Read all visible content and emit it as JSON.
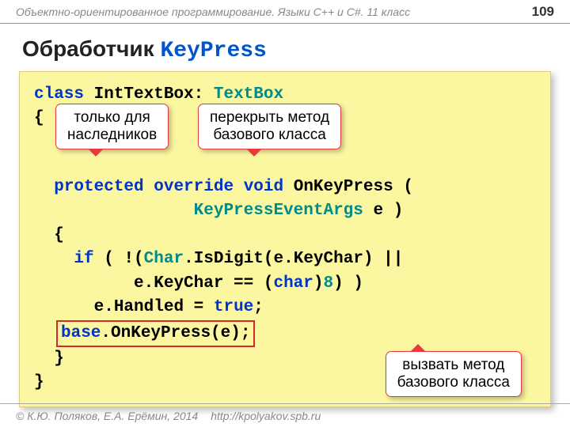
{
  "header": {
    "course": "Объектно-ориентированное программирование. Языки C++ и C#. 11 класс",
    "page": "109"
  },
  "title": {
    "text": "Обработчик ",
    "keyword": "KeyPress"
  },
  "callouts": {
    "protected": "только для\nнаследников",
    "override": "перекрыть метод\nбазового класса",
    "base": "вызвать метод\nбазового класса"
  },
  "code": {
    "l1_kw1": "class",
    "l1_name": "IntTextBox",
    "l1_colon": ":",
    "l1_base": "TextBox",
    "l2": "{",
    "l3_kw1": "protected",
    "l3_kw2": "override",
    "l3_kw3": "void",
    "l3_name": "OnKeyPress",
    "l3_paren": "(",
    "l4_type": "KeyPressEventArgs",
    "l4_arg": "e",
    "l4_close": ")",
    "l5": "{",
    "l6_kw": "if",
    "l6_open": "( !(",
    "l6_char": "Char",
    "l6_mid": ".IsDigit(e.KeyChar) ||",
    "l7_a": "e.KeyChar == (",
    "l7_cast": "char",
    "l7_b": ")",
    "l7_num": "8",
    "l7_c": ") )",
    "l8_a": "e.Handled = ",
    "l8_true": "true",
    "l8_semi": ";",
    "l9_base": "base",
    "l9_rest": ".OnKeyPress(e);",
    "l10": "}",
    "l11": "}"
  },
  "footer": {
    "copyright": "© К.Ю. Поляков, Е.А. Ерёмин, 2014",
    "url": "http://kpolyakov.spb.ru"
  }
}
